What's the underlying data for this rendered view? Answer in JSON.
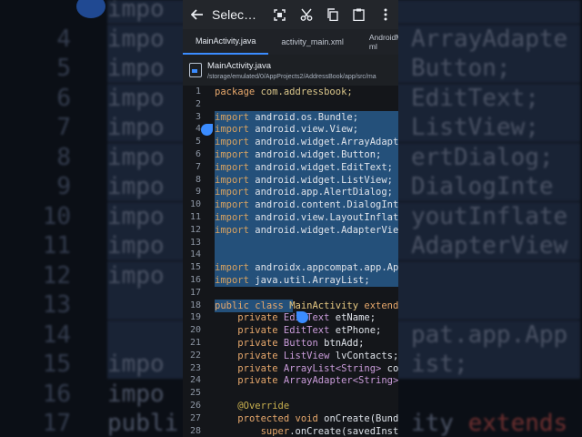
{
  "background_lines": [
    {
      "num": "",
      "text": "impo",
      "sel": true
    },
    {
      "num": "4",
      "text": "impo",
      "sel": true,
      "right": "ArrayAdapte"
    },
    {
      "num": "5",
      "text": "impo",
      "sel": true,
      "right": "Button;"
    },
    {
      "num": "6",
      "text": "impo",
      "sel": true,
      "right": "EditText;"
    },
    {
      "num": "7",
      "text": "impo",
      "sel": true,
      "right": "ListView;"
    },
    {
      "num": "8",
      "text": "impo",
      "sel": true,
      "right": "ertDialog;"
    },
    {
      "num": "9",
      "text": "impo",
      "sel": true,
      "right": "DialogInte"
    },
    {
      "num": "10",
      "text": "impo",
      "sel": true,
      "right": "youtInflate"
    },
    {
      "num": "11",
      "text": "impo",
      "sel": true,
      "right": "AdapterView"
    },
    {
      "num": "12",
      "text": "impo",
      "sel": true,
      "right": ""
    },
    {
      "num": "13",
      "text": "",
      "sel": true,
      "right": ""
    },
    {
      "num": "14",
      "text": "",
      "sel": true,
      "right": "pat.app.App"
    },
    {
      "num": "15",
      "text": "impo",
      "sel": true,
      "right": "ist;"
    },
    {
      "num": "16",
      "text": "impo",
      "sel": false,
      "right": ""
    },
    {
      "num": "17",
      "text": "publi",
      "sel": false,
      "right": "ity extends"
    }
  ],
  "appbar": {
    "back_icon": "arrow-left-icon",
    "title": "Selec…",
    "icons": [
      "select-all-icon",
      "cut-icon",
      "copy-icon",
      "paste-icon",
      "more-vert-icon"
    ]
  },
  "tabs": [
    {
      "label": "MainActivity.java",
      "active": true
    },
    {
      "label": "activity_main.xml",
      "active": false
    },
    {
      "label": "AndroidMani\nml",
      "active": false
    }
  ],
  "file": {
    "name": "MainActivity.java",
    "path": "/storage/emulated/0/AppProjects2/AddressBook/app/src/ma"
  },
  "code_lines": [
    {
      "n": "1",
      "sel": false,
      "t": [
        [
          "kw",
          "package "
        ],
        [
          "pkg",
          "com.addressbook;"
        ]
      ]
    },
    {
      "n": "2",
      "sel": false,
      "t": []
    },
    {
      "n": "3",
      "sel": true,
      "t": [
        [
          "kw2",
          "import "
        ],
        [
          "id",
          "android.os.Bundle;"
        ]
      ]
    },
    {
      "n": "4",
      "sel": true,
      "t": [
        [
          "kw2",
          "import "
        ],
        [
          "id",
          "android.view.View;"
        ]
      ]
    },
    {
      "n": "5",
      "sel": true,
      "t": [
        [
          "kw2",
          "import "
        ],
        [
          "id",
          "android.widget.ArrayAdapter"
        ]
      ]
    },
    {
      "n": "6",
      "sel": true,
      "t": [
        [
          "kw2",
          "import "
        ],
        [
          "id",
          "android.widget.Button;"
        ]
      ]
    },
    {
      "n": "7",
      "sel": true,
      "t": [
        [
          "kw2",
          "import "
        ],
        [
          "id",
          "android.widget.EditText;"
        ]
      ]
    },
    {
      "n": "8",
      "sel": true,
      "t": [
        [
          "kw2",
          "import "
        ],
        [
          "id",
          "android.widget.ListView;"
        ]
      ]
    },
    {
      "n": "9",
      "sel": true,
      "t": [
        [
          "kw2",
          "import "
        ],
        [
          "id",
          "android.app.AlertDialog;"
        ]
      ]
    },
    {
      "n": "10",
      "sel": true,
      "t": [
        [
          "kw2",
          "import "
        ],
        [
          "id",
          "android.content.DialogInte"
        ]
      ]
    },
    {
      "n": "11",
      "sel": true,
      "t": [
        [
          "kw2",
          "import "
        ],
        [
          "id",
          "android.view.LayoutInflate"
        ]
      ]
    },
    {
      "n": "12",
      "sel": true,
      "t": [
        [
          "kw2",
          "import "
        ],
        [
          "id",
          "android.widget.AdapterView"
        ]
      ]
    },
    {
      "n": "13",
      "sel": true,
      "t": []
    },
    {
      "n": "14",
      "sel": true,
      "t": []
    },
    {
      "n": "15",
      "sel": true,
      "t": [
        [
          "kw2",
          "import "
        ],
        [
          "id",
          "androidx.appcompat.app.App"
        ]
      ]
    },
    {
      "n": "16",
      "sel": true,
      "t": [
        [
          "kw2",
          "import "
        ],
        [
          "id",
          "java.util.ArrayList;"
        ]
      ]
    },
    {
      "n": "17",
      "sel": false,
      "t": []
    },
    {
      "n": "18",
      "sel": "partial",
      "t": [
        [
          "kw",
          "public class "
        ],
        [
          "cls",
          "MainActivity "
        ],
        [
          "kw",
          "extends"
        ]
      ]
    },
    {
      "n": "19",
      "sel": false,
      "t": [
        [
          "id",
          "    "
        ],
        [
          "kw",
          "private "
        ],
        [
          "type",
          "EditText "
        ],
        [
          "id",
          "etName;"
        ]
      ]
    },
    {
      "n": "20",
      "sel": false,
      "t": [
        [
          "id",
          "    "
        ],
        [
          "kw",
          "private "
        ],
        [
          "type",
          "EditText "
        ],
        [
          "id",
          "etPhone;"
        ]
      ]
    },
    {
      "n": "21",
      "sel": false,
      "t": [
        [
          "id",
          "    "
        ],
        [
          "kw",
          "private "
        ],
        [
          "type",
          "Button "
        ],
        [
          "id",
          "btnAdd;"
        ]
      ]
    },
    {
      "n": "22",
      "sel": false,
      "t": [
        [
          "id",
          "    "
        ],
        [
          "kw",
          "private "
        ],
        [
          "type",
          "ListView "
        ],
        [
          "id",
          "lvContacts;"
        ]
      ]
    },
    {
      "n": "23",
      "sel": false,
      "t": [
        [
          "id",
          "    "
        ],
        [
          "kw",
          "private "
        ],
        [
          "type",
          "ArrayList<String> "
        ],
        [
          "id",
          "con"
        ]
      ]
    },
    {
      "n": "24",
      "sel": false,
      "t": [
        [
          "id",
          "    "
        ],
        [
          "kw",
          "private "
        ],
        [
          "type",
          "ArrayAdapter<String> "
        ]
      ]
    },
    {
      "n": "25",
      "sel": false,
      "t": []
    },
    {
      "n": "26",
      "sel": false,
      "t": [
        [
          "id",
          "    "
        ],
        [
          "ann",
          "@Override"
        ]
      ]
    },
    {
      "n": "27",
      "sel": false,
      "t": [
        [
          "id",
          "    "
        ],
        [
          "kw",
          "protected void "
        ],
        [
          "mth",
          "onCreate(Bundl"
        ]
      ]
    },
    {
      "n": "28",
      "sel": false,
      "t": [
        [
          "id",
          "        "
        ],
        [
          "kw",
          "super"
        ],
        [
          "mth",
          ".onCreate(savedInsta"
        ]
      ]
    }
  ],
  "colors": {
    "accent": "#3b8cff",
    "selection": "#24507a"
  }
}
